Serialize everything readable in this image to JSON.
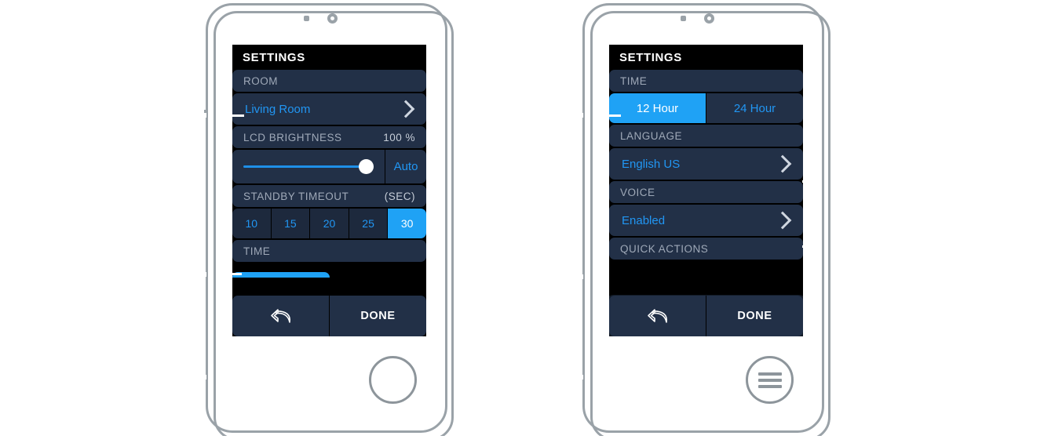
{
  "page": {
    "background": "#ffffff",
    "accent_blue": "#1fa2f5",
    "link_blue": "#2196f3",
    "card_navy": "#223047",
    "screen_black": "#000000",
    "frame_gray": "#9aa2a8"
  },
  "phones": [
    {
      "id": "left",
      "screen_title": "SETTINGS",
      "home_button_icon": "circle-home-button",
      "rows": [
        {
          "type": "header",
          "label": "ROOM"
        },
        {
          "type": "value",
          "label": "Living Room",
          "chevron": "chevron-right-icon"
        },
        {
          "type": "header",
          "label": "LCD BRIGHTNESS",
          "value": "100 %"
        },
        {
          "type": "slider",
          "percent": 100,
          "auto_label": "Auto"
        },
        {
          "type": "header",
          "label": "STANDBY TIMEOUT",
          "value": "(SEC)"
        },
        {
          "type": "segmented",
          "options": [
            "10",
            "15",
            "20",
            "25",
            "30"
          ],
          "selected": "30"
        },
        {
          "type": "header",
          "label": "TIME"
        }
      ],
      "bottom_bar": {
        "back_icon": "back-arrow-icon",
        "done_label": "DONE"
      }
    },
    {
      "id": "right",
      "screen_title": "SETTINGS",
      "home_button_icon": "hamburger-menu-icon",
      "rows": [
        {
          "type": "header",
          "label": "TIME"
        },
        {
          "type": "segmented",
          "options": [
            "12 Hour",
            "24 Hour"
          ],
          "selected": "12 Hour"
        },
        {
          "type": "header",
          "label": "LANGUAGE"
        },
        {
          "type": "value",
          "label": "English US",
          "chevron": "chevron-right-icon"
        },
        {
          "type": "header",
          "label": "VOICE"
        },
        {
          "type": "value",
          "label": "Enabled",
          "chevron": "chevron-right-icon"
        },
        {
          "type": "header",
          "label": "QUICK ACTIONS"
        }
      ],
      "bottom_bar": {
        "back_icon": "back-arrow-icon",
        "done_label": "DONE"
      }
    }
  ]
}
